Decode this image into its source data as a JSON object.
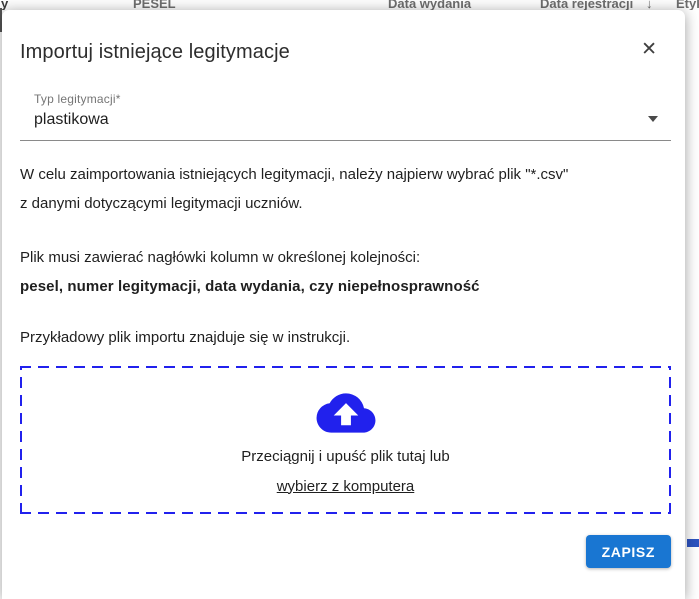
{
  "background": {
    "fragments": [
      {
        "text": "y"
      },
      {
        "text": "PESEL"
      },
      {
        "text": "Data wydania"
      },
      {
        "text": "Data rejestracji"
      },
      {
        "text": "↓"
      },
      {
        "text": "Etykie"
      }
    ]
  },
  "dialog": {
    "title": "Importuj istniejące legitymacje",
    "close_glyph": "✕",
    "type_select": {
      "label": "Typ legitymacji*",
      "value": "plastikowa"
    },
    "intro_line1": "W celu zaimportowania istniejących legitymacji, należy najpierw wybrać plik \"*.csv\"",
    "intro_line2": "z danymi dotyczącymi legitymacji uczniów.",
    "headers_line": "Plik musi zawierać nagłówki kolumn w określonej kolejności:",
    "headers_bold": "pesel, numer legitymacji, data wydania, czy niepełnosprawność",
    "example_line": "Przykładowy plik importu znajduje się w instrukcji.",
    "dropzone": {
      "drag_text": "Przeciągnij i upuść plik tutaj lub",
      "browse_link": "wybierz z komputera"
    },
    "save_button": "ZAPISZ"
  },
  "colors": {
    "accent_blue": "#2121ed",
    "button_blue": "#1976d2",
    "text_dark": "#1f1f1f",
    "label_gray": "#757575"
  }
}
